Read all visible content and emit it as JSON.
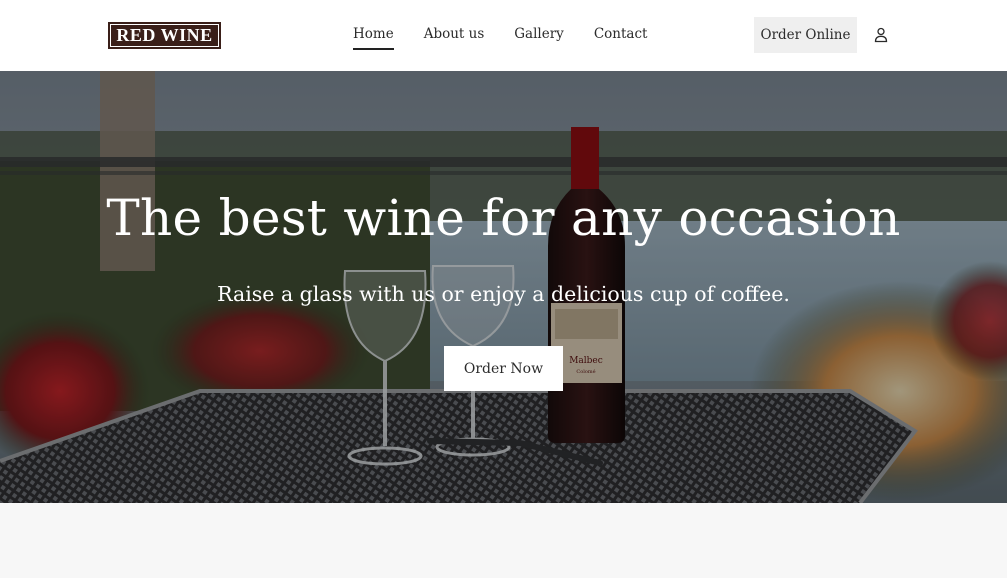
{
  "brand": {
    "logo_text": "RED WINE",
    "logo_color": "#3a1f19"
  },
  "nav": {
    "items": [
      {
        "label": "Home",
        "active": true
      },
      {
        "label": "About us",
        "active": false
      },
      {
        "label": "Gallery",
        "active": false
      },
      {
        "label": "Contact",
        "active": false
      }
    ]
  },
  "header_actions": {
    "order_online_label": "Order Online",
    "account_icon": "user-icon"
  },
  "hero": {
    "title": "The best wine for any occasion",
    "subtitle": "Raise a glass with us or enjoy a delicious cup of coffee.",
    "cta_label": "Order Now",
    "background_image": "wine bottle and glasses on a metal table by a lake",
    "bottle_label": {
      "line1": "Malbec",
      "line2": "Colomé"
    }
  },
  "colors": {
    "header_bg": "#ffffff",
    "page_bg": "#f7f7f7",
    "button_light": "#efefef",
    "text_dark": "#2b2b2b"
  }
}
